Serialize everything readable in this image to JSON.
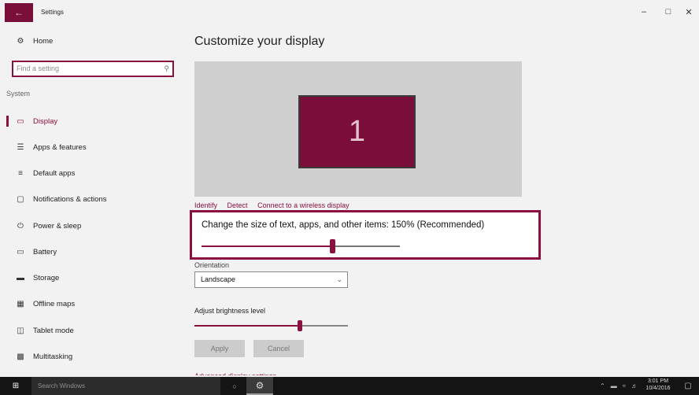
{
  "window": {
    "back_icon": "back-arrow-icon",
    "title": "Settings",
    "controls": [
      "minimize-icon",
      "maximize-icon",
      "close-icon"
    ]
  },
  "sidebar": {
    "home": {
      "label": "Home",
      "icon": "gear-icon"
    },
    "search": {
      "placeholder": "Find a setting",
      "icon": "search-icon"
    },
    "section": "System",
    "items": [
      {
        "label": "Display",
        "icon": "monitor-icon",
        "active": true
      },
      {
        "label": "Apps & features",
        "icon": "apps-list-icon"
      },
      {
        "label": "Default apps",
        "icon": "default-apps-icon"
      },
      {
        "label": "Notifications & actions",
        "icon": "notification-icon"
      },
      {
        "label": "Power & sleep",
        "icon": "power-icon"
      },
      {
        "label": "Battery",
        "icon": "battery-icon"
      },
      {
        "label": "Storage",
        "icon": "storage-icon"
      },
      {
        "label": "Offline maps",
        "icon": "map-icon"
      },
      {
        "label": "Tablet mode",
        "icon": "tablet-icon"
      },
      {
        "label": "Multitasking",
        "icon": "multitasking-icon"
      }
    ]
  },
  "main": {
    "title": "Customize your display",
    "display_number": "1",
    "links": [
      "Identify",
      "Detect",
      "Connect to a wireless display"
    ],
    "scale_label": "Change the size of text, apps, and other items: 150% (Recommended)",
    "scale_level": 0.65,
    "orientation_label": "Orientation",
    "orientation_value": "Landscape",
    "brightness_label": "Adjust brightness level",
    "brightness_level": 0.69,
    "apply_label": "Apply",
    "cancel_label": "Cancel",
    "advanced_link": "Advanced display settings"
  },
  "taskbar": {
    "search_placeholder": "Search Windows",
    "time": "3:01 PM",
    "date": "10/4/2016"
  },
  "colors": {
    "accent": "#8a1040",
    "monitor": "#7b0d3a",
    "taskbar": "#141414"
  }
}
